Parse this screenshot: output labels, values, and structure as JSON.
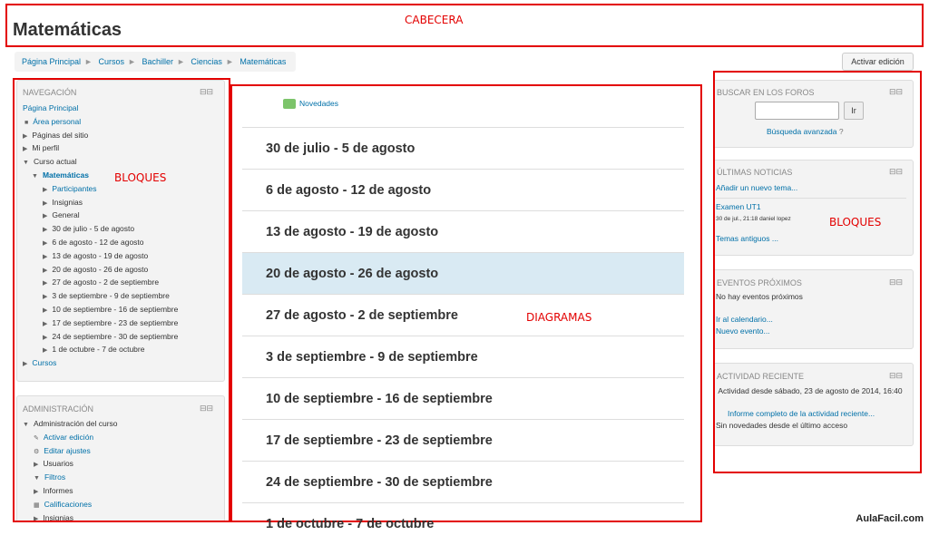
{
  "header": {
    "title": "Matemáticas",
    "annotation": "CABECERA"
  },
  "breadcrumb": [
    "Página Principal",
    "Cursos",
    "Bachiller",
    "Ciencias",
    "Matemáticas"
  ],
  "edit_button": "Activar edición",
  "nav": {
    "title": "NAVEGACIÓN",
    "home": "Página Principal",
    "items": [
      {
        "label": "Área personal",
        "link": true
      },
      {
        "label": "Páginas del sitio",
        "link": false
      },
      {
        "label": "Mi perfil",
        "link": false
      },
      {
        "label": "Curso actual",
        "link": false
      },
      {
        "label": "Matemáticas",
        "link": true
      },
      {
        "label": "Participantes",
        "link": true
      },
      {
        "label": "Insignias",
        "link": false
      },
      {
        "label": "General",
        "link": false
      },
      {
        "label": "30 de julio - 5 de agosto",
        "link": false
      },
      {
        "label": "6 de agosto - 12 de agosto",
        "link": false
      },
      {
        "label": "13 de agosto - 19 de agosto",
        "link": false
      },
      {
        "label": "20 de agosto - 26 de agosto",
        "link": false
      },
      {
        "label": "27 de agosto - 2 de septiembre",
        "link": false
      },
      {
        "label": "3 de septiembre - 9 de septiembre",
        "link": false
      },
      {
        "label": "10 de septiembre - 16 de septiembre",
        "link": false
      },
      {
        "label": "17 de septiembre - 23 de septiembre",
        "link": false
      },
      {
        "label": "24 de septiembre - 30 de septiembre",
        "link": false
      },
      {
        "label": "1 de octubre - 7 de octubre",
        "link": false
      },
      {
        "label": "Cursos",
        "link": true
      }
    ]
  },
  "admin": {
    "title": "ADMINISTRACIÓN",
    "items": [
      "Administración del curso",
      "Activar edición",
      "Editar ajustes",
      "Usuarios",
      "Filtros",
      "Informes",
      "Calificaciones",
      "Insignias"
    ]
  },
  "annotations": {
    "blocks_left": "BLOQUES",
    "diagrams": "DIAGRAMAS",
    "blocks_right": "BLOQUES"
  },
  "main": {
    "news": "Novedades",
    "weeks": [
      "30 de julio - 5 de agosto",
      "6 de agosto - 12 de agosto",
      "13 de agosto - 19 de agosto",
      "20 de agosto - 26 de agosto",
      "27 de agosto - 2 de septiembre",
      "3 de septiembre - 9 de septiembre",
      "10 de septiembre - 16 de septiembre",
      "17 de septiembre - 23 de septiembre",
      "24 de septiembre - 30 de septiembre",
      "1 de octubre - 7 de octubre"
    ]
  },
  "search": {
    "title": "BUSCAR EN LOS FOROS",
    "button": "Ir",
    "advanced": "Búsqueda avanzada"
  },
  "news_block": {
    "title": "ÚLTIMAS NOTICIAS",
    "add": "Añadir un nuevo tema...",
    "item_title": "Examen UT1",
    "item_meta": "30 de jul., 21:18  daniel lopez",
    "old": "Temas antiguos ..."
  },
  "events": {
    "title": "EVENTOS PRÓXIMOS",
    "none": "No hay eventos próximos",
    "calendar": "Ir al calendario...",
    "new": "Nuevo evento..."
  },
  "activity": {
    "title": "ACTIVIDAD RECIENTE",
    "since": "Actividad desde sábado, 23 de agosto de 2014, 16:40",
    "report": "Informe completo de la actividad reciente...",
    "none": "Sin novedades desde el último acceso"
  },
  "watermark": "AulaFacil.com"
}
